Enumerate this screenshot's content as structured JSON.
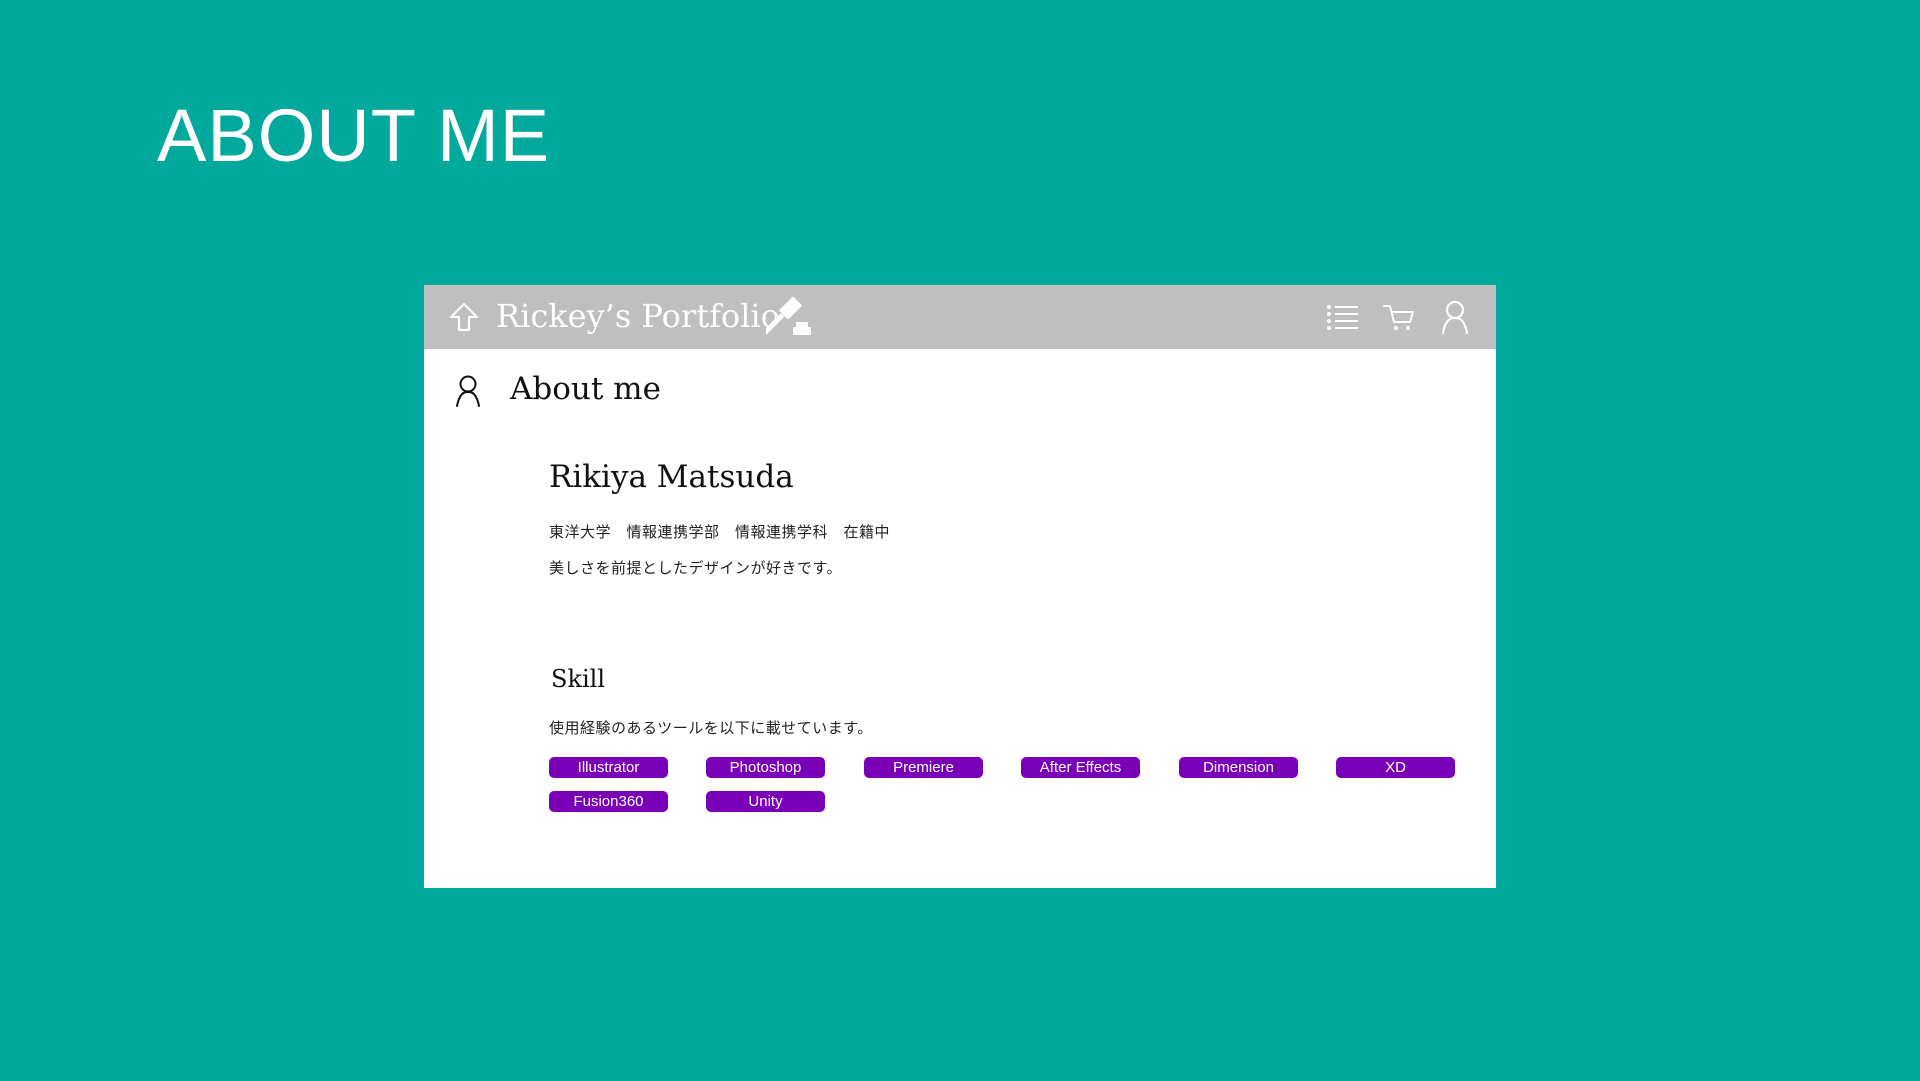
{
  "slide": {
    "title": "ABOUT ME",
    "background_color": "#01a99d"
  },
  "app": {
    "header_color": "#bfbfbf",
    "title": "Rickey’s Portfolio",
    "icons": {
      "home": "home-arrow-up-icon",
      "logo": "gavel-icon",
      "menu": "list-menu-icon",
      "cart": "cart-icon",
      "account": "user-icon"
    }
  },
  "section": {
    "icon": "user-icon",
    "title": "About me"
  },
  "profile": {
    "name": "Rikiya Matsuda",
    "affiliation": "東洋大学　情報連携学部　情報連携学科　在籍中",
    "statement": "美しさを前提としたデザインが好きです。"
  },
  "skills": {
    "title": "Skill",
    "description": "使用経験のあるツールを以下に載せています。",
    "tag_color": "#7a00b8",
    "items": [
      "Illustrator",
      "Photoshop",
      "Premiere",
      "After Effects",
      "Dimension",
      "XD",
      "Fusion360",
      "Unity"
    ]
  }
}
